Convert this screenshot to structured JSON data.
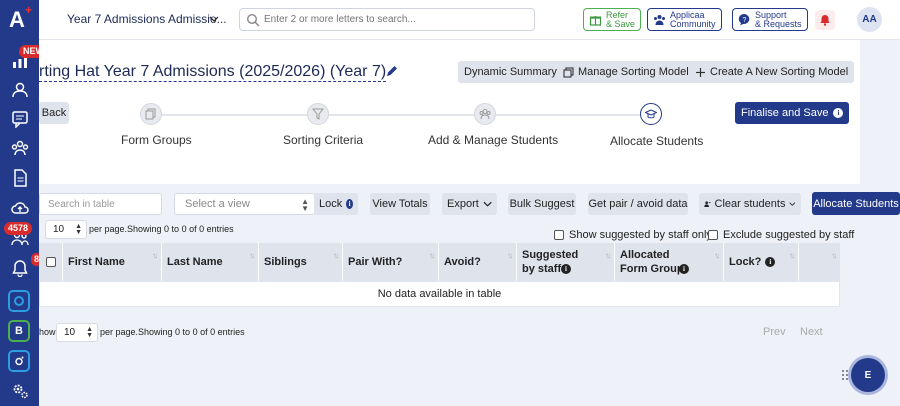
{
  "app": {
    "logo": "A",
    "logo_plus": "+"
  },
  "rail": {
    "items": [
      {
        "name": "dashboard-icon",
        "badge": "NEW"
      },
      {
        "name": "users-icon"
      },
      {
        "name": "messages-icon"
      },
      {
        "name": "groups-icon"
      },
      {
        "name": "document-icon"
      },
      {
        "name": "cloud-upload-icon"
      },
      {
        "name": "applicants-icon",
        "badge": "4578"
      },
      {
        "name": "notifications-icon",
        "badge": "8"
      },
      {
        "name": "o-app-icon"
      },
      {
        "name": "b-app-icon",
        "label": "B"
      },
      {
        "name": "instagram-icon"
      },
      {
        "name": "settings-icon"
      }
    ]
  },
  "topbar": {
    "workspace": "Year 7 Admissions Admissio...",
    "search_placeholder": "Enter 2 or more letters to search...",
    "refer_line1": "Refer",
    "refer_line2": "& Save",
    "community_line1": "Applicaa",
    "community_line2": "Community",
    "support_line1": "Support",
    "support_line2": "& Requests",
    "avatar": "AA"
  },
  "header": {
    "title": "rting Hat Year 7 Admissions (2025/2026) (Year 7)",
    "dynamic_summary": "Dynamic Summary",
    "manage_models": "Manage Sorting Models",
    "create_model": "Create A New Sorting Model",
    "back": "Back",
    "finalise": "Finalise and Save"
  },
  "steps": [
    {
      "label": "Form Groups"
    },
    {
      "label": "Sorting Criteria"
    },
    {
      "label": "Add & Manage Students"
    },
    {
      "label": "Allocate Students",
      "active": true
    }
  ],
  "controls": {
    "search_placeholder": "Search in table",
    "view_placeholder": "Select a view",
    "lock": "Lock",
    "view_totals": "View Totals",
    "export": "Export",
    "bulk_suggest": "Bulk Suggest",
    "pair_avoid": "Get pair / avoid data",
    "clear_students": "Clear students",
    "allocate": "Allocate Students",
    "per_page_value": "10",
    "per_page_text": "per page.Showing 0 to 0 of 0 entries",
    "show_suggested": "Show suggested by staff only",
    "exclude_suggested": "Exclude suggested by staff"
  },
  "table": {
    "headers": [
      "First Name",
      "Last Name",
      "Siblings",
      "Pair With?",
      "Avoid?",
      "Suggested by staff",
      "Allocated Form Group",
      "Lock?"
    ],
    "empty": "No data available in table"
  },
  "footer": {
    "show_prefix": "how",
    "per_page_value": "10",
    "per_page_text": "per page.Showing 0 to 0 of 0 entries",
    "prev": "Prev",
    "next": "Next",
    "fab": "E"
  }
}
